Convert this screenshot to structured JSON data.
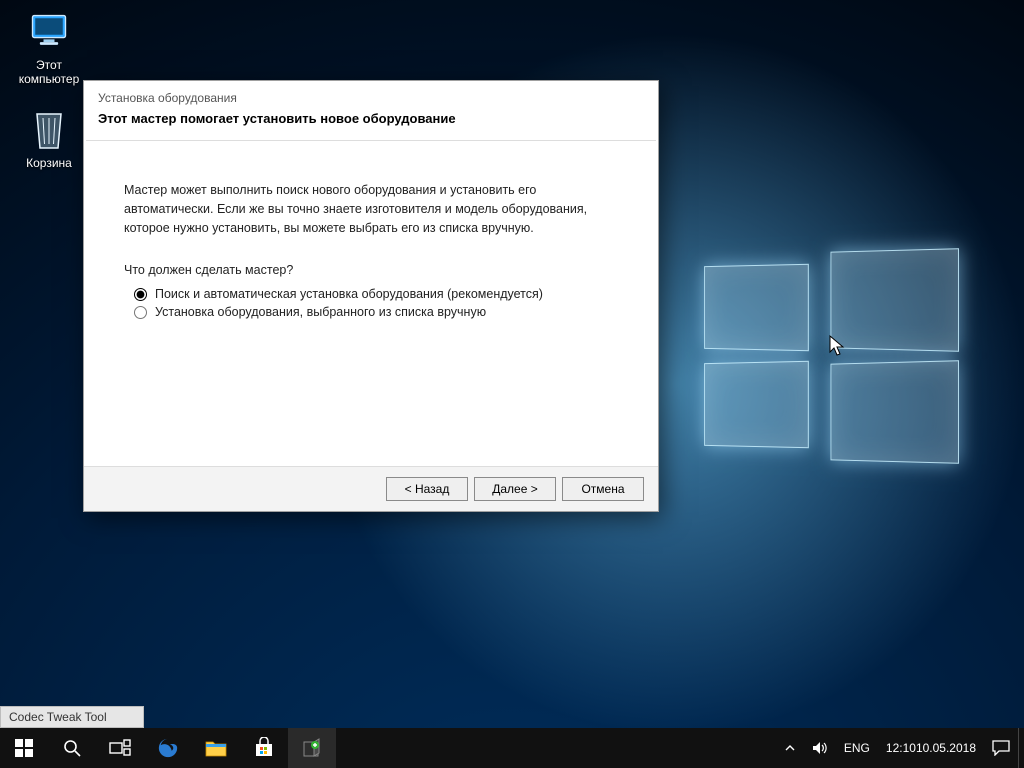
{
  "desktop": {
    "icons": {
      "computer_label": "Этот компьютер",
      "bin_label": "Корзина"
    },
    "codec_tool_label": "Codec Tweak Tool"
  },
  "wizard": {
    "title": "Установка оборудования",
    "heading": "Этот мастер помогает установить новое оборудование",
    "description": "Мастер может выполнить поиск нового оборудования и установить его автоматически. Если же вы точно знаете изготовителя и модель оборудования, которое нужно установить, вы можете выбрать его из списка вручную.",
    "question": "Что должен сделать мастер?",
    "option_auto": "Поиск и автоматическая установка оборудования (рекомендуется)",
    "option_manual": "Установка оборудования, выбранного из списка вручную",
    "selected_option": "auto",
    "buttons": {
      "back": "< Назад",
      "next": "Далее >",
      "cancel": "Отмена"
    }
  },
  "taskbar": {
    "lang": "ENG",
    "time": "12:10",
    "date": "10.05.2018"
  }
}
